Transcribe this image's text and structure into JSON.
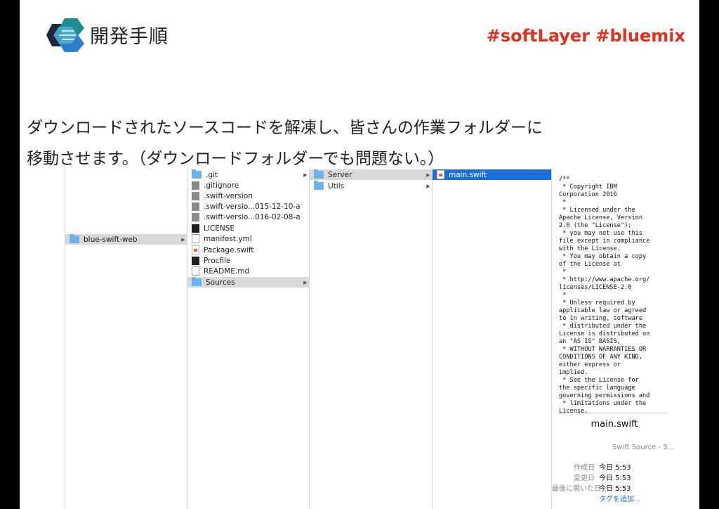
{
  "slide": {
    "title": "開発手順",
    "hashtags": "#softLayer #bluemix",
    "body_lines": [
      "ダウンロードされたソースコードを解凍し、皆さんの作業フォルダーに",
      "移動させます。（ダウンロードフォルダーでも問題ない。）"
    ]
  },
  "finder": {
    "col1": [
      {
        "label": "blue-swift-web",
        "icon": "folder-icon",
        "selected": "gray",
        "arrow": "▶"
      }
    ],
    "col2": [
      {
        "label": ".git",
        "icon": "folder-icon",
        "arrow": "▶"
      },
      {
        "label": ".gitignore",
        "icon": "document-icon",
        "arrow": ""
      },
      {
        "label": ".swift-version",
        "icon": "document-icon",
        "arrow": ""
      },
      {
        "label": ".swift-versio...015-12-10-a",
        "icon": "document-icon",
        "arrow": ""
      },
      {
        "label": ".swift-versio...016-02-08-a",
        "icon": "document-icon",
        "arrow": ""
      },
      {
        "label": "LICENSE",
        "icon": "terminal-document-icon",
        "arrow": ""
      },
      {
        "label": "manifest.yml",
        "icon": "text-document-icon",
        "arrow": ""
      },
      {
        "label": "Package.swift",
        "icon": "swift-file-icon",
        "arrow": ""
      },
      {
        "label": "Procfile",
        "icon": "terminal-document-icon",
        "arrow": ""
      },
      {
        "label": "README.md",
        "icon": "text-document-icon",
        "arrow": ""
      },
      {
        "label": "Sources",
        "icon": "folder-icon",
        "selected": "gray",
        "arrow": "▶"
      }
    ],
    "col3": [
      {
        "label": "Server",
        "icon": "folder-icon",
        "selected": "gray",
        "arrow": "▶"
      },
      {
        "label": "Utils",
        "icon": "folder-icon",
        "arrow": "▶"
      }
    ],
    "col4": [
      {
        "label": "main.swift",
        "icon": "swift-file-icon",
        "selected": "blue",
        "arrow": ""
      }
    ],
    "preview": {
      "code": "/**\n * Copyright IBM\nCorporation 2016\n *\n * Licensed under the\nApache License, Version\n2.0 (the \"License\");\n * you may not use this\nfile except in compliance\nwith the License.\n * You may obtain a copy\nof the License at\n *\n * http://www.apache.org/\nlicenses/LICENSE-2.0\n *\n * Unless required by\napplicable law or agreed\nto in writing, software\n * distributed under the\nLicense is distributed on\nan \"AS IS\" BASIS,\n * WITHOUT WARRANTIES OR\nCONDITIONS OF ANY KIND,\neither express or\nimplied.\n * See the License for\nthe specific language\ngoverning permissions and\n * limitations under the\nLicense.",
      "filename": "main.swift",
      "kind": "Swift Source - 3...",
      "meta": [
        {
          "key": "作成日",
          "value": "今日 5:53"
        },
        {
          "key": "変更日",
          "value": "今日 5:53"
        },
        {
          "key": "最後に開いた日",
          "value": "今日 5:53"
        }
      ],
      "add_tags": "タグを追加..."
    }
  },
  "colors": {
    "hashtag": "#e0301e",
    "selection_blue": "#1a6fd8",
    "folder": "#6ab4ef"
  }
}
